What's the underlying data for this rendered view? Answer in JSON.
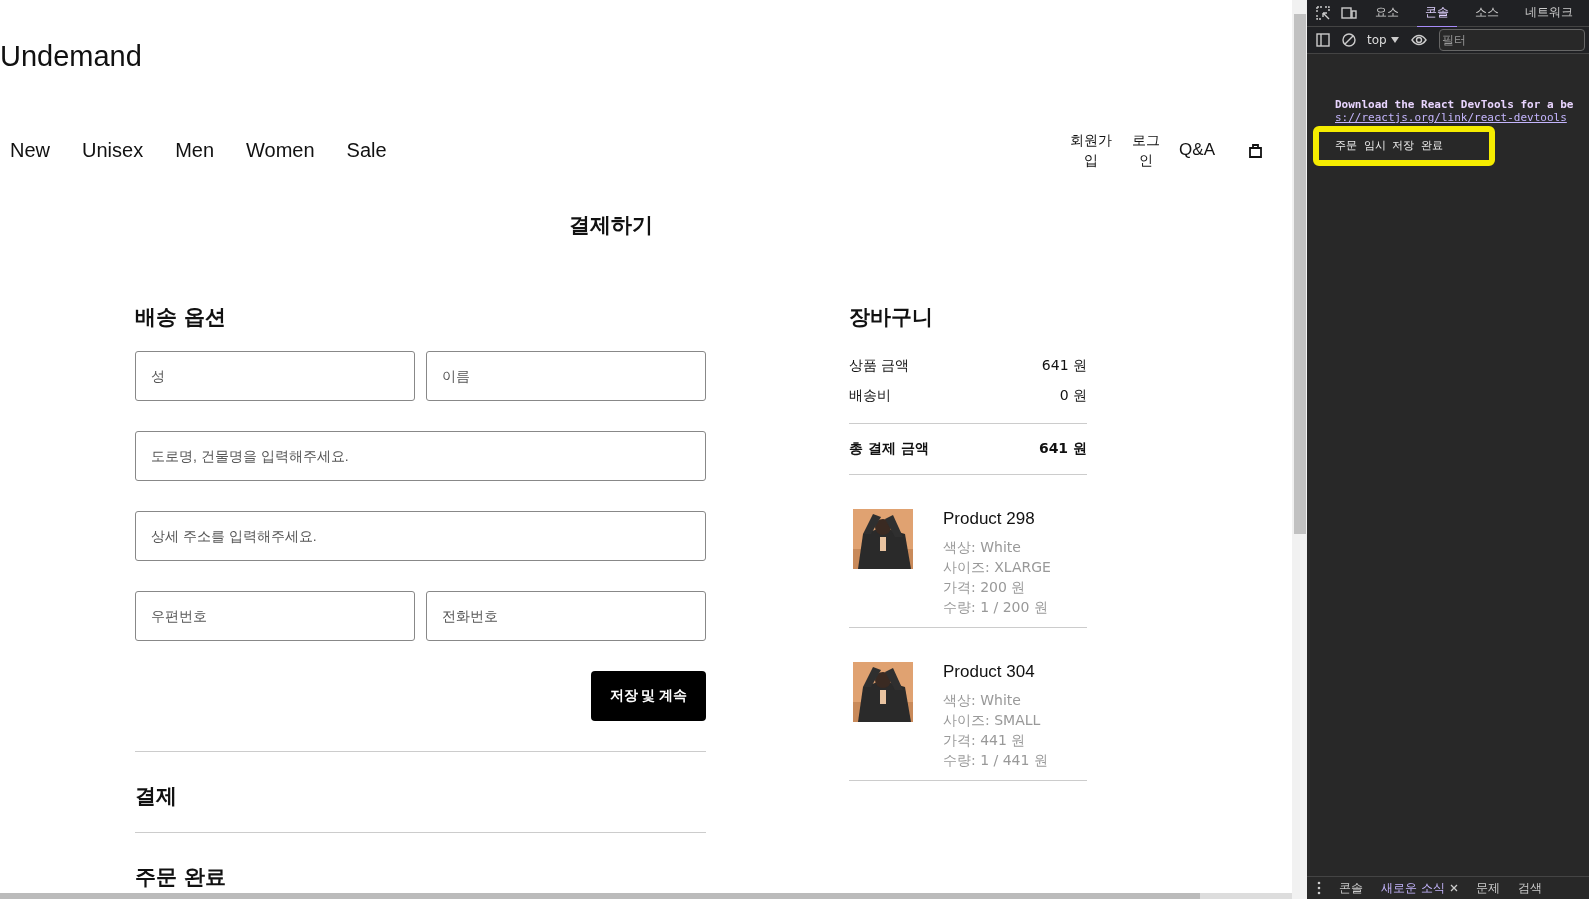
{
  "header": {
    "logo": "Undemand",
    "nav": [
      "New",
      "Unisex",
      "Men",
      "Women",
      "Sale"
    ],
    "account_links": [
      "회원가입",
      "로그인",
      "Q&A"
    ]
  },
  "page_title": "결제하기",
  "shipping": {
    "title": "배송 옵션",
    "fields": [
      {
        "placeholder": "성",
        "kind": "half"
      },
      {
        "placeholder": "이름",
        "kind": "half"
      },
      {
        "placeholder": "도로명, 건물명을 입력해주세요.",
        "kind": "full"
      },
      {
        "placeholder": "상세 주소를 입력해주세요.",
        "kind": "full"
      },
      {
        "placeholder": "우편번호",
        "kind": "half"
      },
      {
        "placeholder": "전화번호",
        "kind": "half"
      }
    ],
    "button": "저장 및 계속"
  },
  "sections": [
    "결제",
    "주문 완료"
  ],
  "cart": {
    "title": "장바구니",
    "summary": [
      {
        "label": "상품 금액",
        "value": "641 원",
        "total": false
      },
      {
        "label": "배송비",
        "value": "0 원",
        "total": false
      },
      {
        "label": "총 결제 금액",
        "value": "641 원",
        "total": true
      }
    ],
    "items": [
      {
        "name": "Product 298",
        "details": [
          "색상: White",
          "사이즈: XLARGE",
          "가격: 200 원",
          "수량: 1 / 200 원"
        ]
      },
      {
        "name": "Product 304",
        "details": [
          "색상: White",
          "사이즈: SMALL",
          "가격: 441 원",
          "수량: 1 / 441 원"
        ]
      }
    ]
  },
  "devtools": {
    "tabs": [
      {
        "label": "요소",
        "selected": false
      },
      {
        "label": "콘솔",
        "selected": true
      },
      {
        "label": "소스",
        "selected": false
      },
      {
        "label": "네트워크",
        "selected": false
      }
    ],
    "context": "top",
    "filter_placeholder": "필터",
    "messages": [
      {
        "text": "Download the React DevTools for a be",
        "link": "s://reactjs.org/link/react-devtools",
        "highlighted": false
      },
      {
        "text": "주문 임시 저장 완료",
        "highlighted": true
      }
    ],
    "drawer_tabs": [
      {
        "label": "콘솔",
        "selected": false,
        "closable": false
      },
      {
        "label": "새로운 소식",
        "selected": true,
        "closable": true
      },
      {
        "label": "문제",
        "selected": false,
        "closable": false
      },
      {
        "label": "검색",
        "selected": false,
        "closable": false
      }
    ]
  }
}
